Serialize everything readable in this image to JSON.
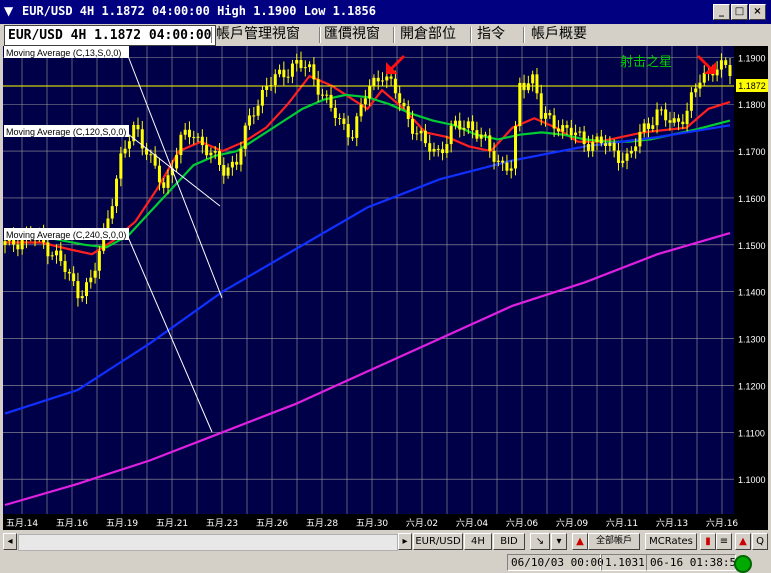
{
  "window": {
    "title": "EUR/USD 4H 1.1872 04:00:00 High 1.1900 Low 1.1856",
    "minimize": "_",
    "maximize": "□",
    "close": "×"
  },
  "tabs": [
    {
      "label": "EUR/USD 4H 1.1872 04:00:00",
      "active": true
    },
    {
      "label": "帳戶管理視窗"
    },
    {
      "label": "匯價視窗"
    },
    {
      "label": "開倉部位"
    },
    {
      "label": "指令"
    },
    {
      "label": "帳戶概要"
    }
  ],
  "ma_labels": [
    "Moving Average (C,13,S,0,0)",
    "Moving Average (C,120,S,0,0)",
    "Moving Average (C,240,S,0,0)"
  ],
  "annotation": "射击之星",
  "current_price_tag": "1.1872",
  "colors": {
    "background": "#000048",
    "candle": "#ffff00",
    "ma13": "#ff2020",
    "ma40": "#00cc33",
    "ma120": "#1030ff",
    "ma240": "#e020e0",
    "arrow": "#ff1010",
    "annotation": "#00cc00"
  },
  "bottom_bar": {
    "symbol": "EUR/USD",
    "period": "4H",
    "side": "BID",
    "account_btn": "全部帳戶",
    "rates_btn": "MCRates",
    "zoom_btn": "Q"
  },
  "status": {
    "cursor_time": "06/10/03 00:00",
    "cursor_price": "1.1031",
    "clock": "06-16 01:38:57"
  },
  "chart_data": {
    "type": "candlestick",
    "title": "EUR/USD 4H",
    "ylim": [
      1.093,
      1.192
    ],
    "y_ticks": [
      "1.1900",
      "1.1800",
      "1.1700",
      "1.1600",
      "1.1500",
      "1.1400",
      "1.1300",
      "1.1200",
      "1.1100",
      "1.1000"
    ],
    "x_ticks": [
      "五月.14",
      "五月.16",
      "五月.19",
      "五月.21",
      "五月.23",
      "五月.26",
      "五月.28",
      "五月.30",
      "六月.02",
      "六月.04",
      "六月.06",
      "六月.09",
      "六月.11",
      "六月.13",
      "六月.16"
    ],
    "series": [
      {
        "name": "MA13",
        "points": [
          [
            0,
            1.1505
          ],
          [
            0.05,
            1.1505
          ],
          [
            0.09,
            1.149
          ],
          [
            0.12,
            1.148
          ],
          [
            0.15,
            1.151
          ],
          [
            0.18,
            1.155
          ],
          [
            0.21,
            1.162
          ],
          [
            0.24,
            1.17
          ],
          [
            0.27,
            1.172
          ],
          [
            0.3,
            1.17
          ],
          [
            0.33,
            1.172
          ],
          [
            0.36,
            1.175
          ],
          [
            0.39,
            1.18
          ],
          [
            0.42,
            1.186
          ],
          [
            0.45,
            1.184
          ],
          [
            0.48,
            1.181
          ],
          [
            0.5,
            1.179
          ],
          [
            0.52,
            1.183
          ],
          [
            0.55,
            1.179
          ],
          [
            0.58,
            1.174
          ],
          [
            0.61,
            1.173
          ],
          [
            0.64,
            1.171
          ],
          [
            0.67,
            1.17
          ],
          [
            0.7,
            1.175
          ],
          [
            0.73,
            1.177
          ],
          [
            0.76,
            1.175
          ],
          [
            0.79,
            1.172
          ],
          [
            0.82,
            1.172
          ],
          [
            0.85,
            1.173
          ],
          [
            0.88,
            1.174
          ],
          [
            0.91,
            1.1745
          ],
          [
            0.94,
            1.175
          ],
          [
            0.97,
            1.179
          ],
          [
            1.0,
            1.1805
          ]
        ]
      },
      {
        "name": "MA40",
        "points": [
          [
            0,
            1.152
          ],
          [
            0.06,
            1.1515
          ],
          [
            0.11,
            1.15
          ],
          [
            0.14,
            1.1495
          ],
          [
            0.17,
            1.152
          ],
          [
            0.2,
            1.157
          ],
          [
            0.23,
            1.162
          ],
          [
            0.26,
            1.167
          ],
          [
            0.29,
            1.169
          ],
          [
            0.32,
            1.17
          ],
          [
            0.35,
            1.173
          ],
          [
            0.38,
            1.176
          ],
          [
            0.41,
            1.179
          ],
          [
            0.44,
            1.181
          ],
          [
            0.47,
            1.182
          ],
          [
            0.5,
            1.1815
          ],
          [
            0.53,
            1.18
          ],
          [
            0.56,
            1.178
          ],
          [
            0.59,
            1.1765
          ],
          [
            0.62,
            1.1755
          ],
          [
            0.65,
            1.1735
          ],
          [
            0.68,
            1.1725
          ],
          [
            0.71,
            1.1735
          ],
          [
            0.74,
            1.174
          ],
          [
            0.77,
            1.1735
          ],
          [
            0.8,
            1.1725
          ],
          [
            0.83,
            1.172
          ],
          [
            0.86,
            1.172
          ],
          [
            0.89,
            1.1725
          ],
          [
            0.92,
            1.1735
          ],
          [
            0.95,
            1.1745
          ],
          [
            1.0,
            1.1765
          ]
        ]
      },
      {
        "name": "MA120",
        "points": [
          [
            0,
            1.114
          ],
          [
            0.1,
            1.119
          ],
          [
            0.2,
            1.129
          ],
          [
            0.3,
            1.14
          ],
          [
            0.4,
            1.149
          ],
          [
            0.5,
            1.158
          ],
          [
            0.6,
            1.164
          ],
          [
            0.7,
            1.168
          ],
          [
            0.8,
            1.171
          ],
          [
            0.9,
            1.173
          ],
          [
            1.0,
            1.1755
          ]
        ]
      },
      {
        "name": "MA240",
        "points": [
          [
            0,
            1.0945
          ],
          [
            0.1,
            1.099
          ],
          [
            0.2,
            1.104
          ],
          [
            0.3,
            1.11
          ],
          [
            0.4,
            1.116
          ],
          [
            0.5,
            1.123
          ],
          [
            0.6,
            1.13
          ],
          [
            0.7,
            1.137
          ],
          [
            0.8,
            1.142
          ],
          [
            0.9,
            1.148
          ],
          [
            1.0,
            1.1525
          ]
        ]
      }
    ]
  }
}
